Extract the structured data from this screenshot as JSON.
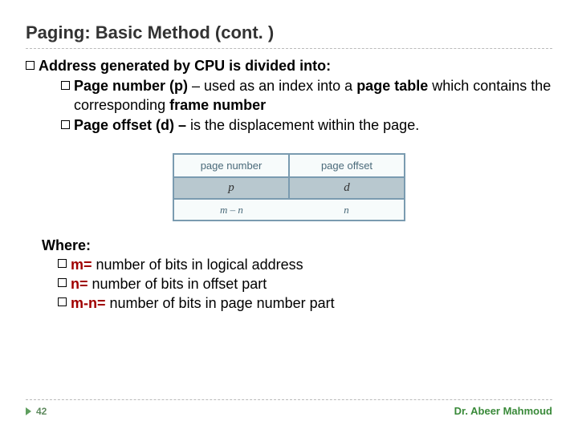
{
  "title": "Paging: Basic Method (cont. )",
  "b1_lead": "Address",
  "b1_rest": " generated by CPU is divided into:",
  "b2_lead": "Page",
  "b2_bold": " number (p)",
  "b2_mid": " – used as an index into a ",
  "b2_bold2": "page table",
  "b2_rest": " which contains the corresponding ",
  "b2_bold3": "frame number",
  "b3_lead": "Page",
  "b3_bold": " offset (d) – ",
  "b3_rest": "is the displacement within the page.",
  "diag": {
    "h1": "page number",
    "h2": "page offset",
    "c1": "p",
    "c2": "d",
    "f1": "m – n",
    "f2": "n"
  },
  "where_label": "Where:",
  "w1_b": "m= ",
  "w1_t": "number of bits in logical address",
  "w2_b": "n= ",
  "w2_t": "number of bits in offset part",
  "w3_b": "m-n= ",
  "w3_t": "number of bits in page number part",
  "page_number": "42",
  "author": "Dr. Abeer Mahmoud"
}
